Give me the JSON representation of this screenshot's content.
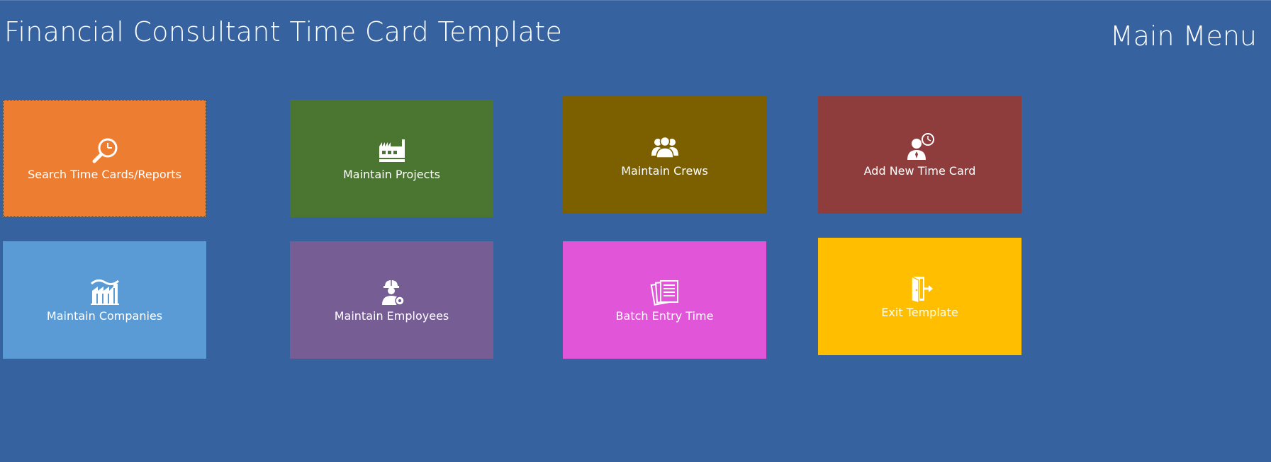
{
  "header": {
    "app_title": "Financial Consultant Time Card Template",
    "menu_title": "Main Menu"
  },
  "colors": {
    "background": "#3762a0",
    "search": "#ed7d31",
    "projects": "#4b7631",
    "crews": "#7c6000",
    "add_time_card": "#8e3c3c",
    "companies": "#5b9bd5",
    "employees": "#765d94",
    "batch": "#e155d8",
    "exit": "#ffbf00"
  },
  "tiles": {
    "search": {
      "label": "Search Time Cards/Reports",
      "icon": "search-clock-icon"
    },
    "projects": {
      "label": "Maintain Projects",
      "icon": "factory-icon"
    },
    "crews": {
      "label": "Maintain Crews",
      "icon": "group-icon"
    },
    "add_time_card": {
      "label": "Add New Time Card",
      "icon": "person-clock-icon"
    },
    "companies": {
      "label": "Maintain Companies",
      "icon": "industry-icon"
    },
    "employees": {
      "label": "Maintain Employees",
      "icon": "worker-gear-icon"
    },
    "batch": {
      "label": "Batch Entry Time",
      "icon": "documents-icon"
    },
    "exit": {
      "label": "Exit Template",
      "icon": "exit-door-icon"
    }
  }
}
